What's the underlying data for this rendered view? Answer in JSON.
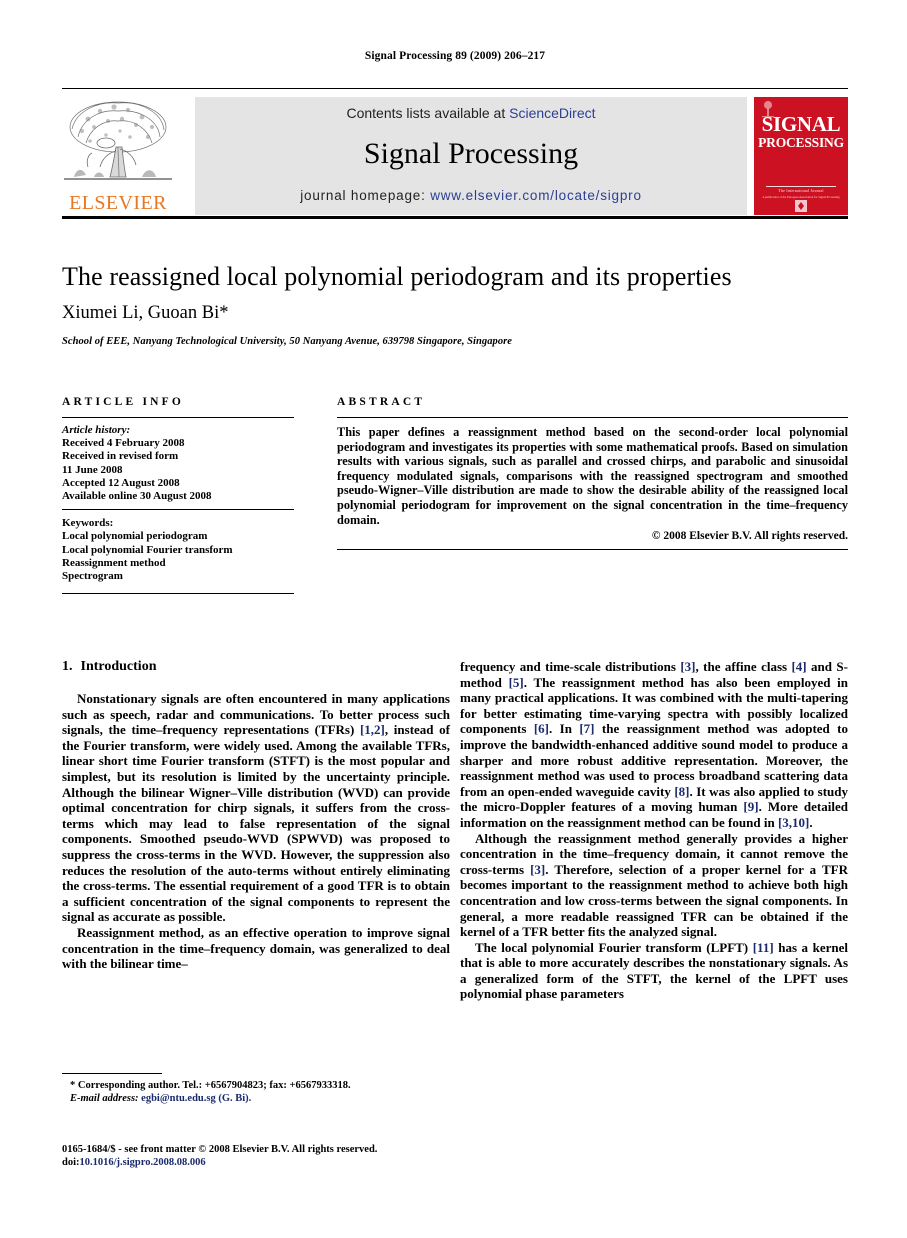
{
  "running_head": "Signal Processing 89 (2009) 206–217",
  "masthead": {
    "contents_prefix": "Contents lists available at ",
    "sciencedirect": "ScienceDirect",
    "journal_name": "Signal Processing",
    "homepage_prefix": "journal homepage: ",
    "homepage_url": "www.elsevier.com/locate/sigpro",
    "publisher_wordmark": "ELSEVIER",
    "cover": {
      "line1": "SIGNAL",
      "line2": "PROCESSING",
      "sub1": "The International Journal",
      "sub2": "A publication of the European Association for Signal Processing"
    },
    "accent_red": "#cc1122",
    "accent_orange": "#E87722",
    "link_blue": "#2b3f93",
    "band_gray": "#e4e4e4"
  },
  "article": {
    "title": "The reassigned local polynomial periodogram and its properties",
    "authors": "Xiumei Li, Guoan Bi*",
    "affiliation": "School of EEE, Nanyang Technological University, 50 Nanyang Avenue, 639798 Singapore, Singapore"
  },
  "info": {
    "heading": "ARTICLE INFO",
    "history_label": "Article history:",
    "history": [
      "Received 4 February 2008",
      "Received in revised form",
      "11 June 2008",
      "Accepted 12 August 2008",
      "Available online 30 August 2008"
    ],
    "keywords_label": "Keywords:",
    "keywords": [
      "Local polynomial periodogram",
      "Local polynomial Fourier transform",
      "Reassignment method",
      "Spectrogram"
    ]
  },
  "abstract": {
    "heading": "ABSTRACT",
    "text": "This paper defines a reassignment method based on the second-order local polynomial periodogram and investigates its properties with some mathematical proofs. Based on simulation results with various signals, such as parallel and crossed chirps, and parabolic and sinusoidal frequency modulated signals, comparisons with the reassigned spectrogram and smoothed pseudo-Wigner–Ville distribution are made to show the desirable ability of the reassigned local polynomial periodogram for improvement on the signal concentration in the time–frequency domain.",
    "copyright": "© 2008 Elsevier B.V. All rights reserved."
  },
  "body": {
    "section_number": "1.",
    "section_title": "Introduction",
    "left_p1_a": "Nonstationary signals are often encountered in many applications such as speech, radar and communications. To better process such signals, the time–frequency representations (TFRs) ",
    "left_p1_ref1": "[1,2]",
    "left_p1_b": ", instead of the Fourier transform, were widely used. Among the available TFRs, linear short time Fourier transform (STFT) is the most popular and simplest, but its resolution is limited by the uncertainty principle. Although the bilinear Wigner–Ville distribution (WVD) can provide optimal concentration for chirp signals, it suffers from the cross-terms which may lead to false representation of the signal components. Smoothed pseudo-WVD (SPWVD) was proposed to suppress the cross-terms in the WVD. However, the suppression also reduces the resolution of the auto-terms without entirely eliminating the cross-terms. The essential requirement of a good TFR is to obtain a sufficient concentration of the signal components to represent the signal as accurate as possible.",
    "left_p2": "Reassignment method, as an effective operation to improve signal concentration in the time–frequency domain, was generalized to deal with the bilinear time–",
    "right_p1_a": "frequency and time-scale distributions ",
    "right_p1_ref3": "[3]",
    "right_p1_b": ", the affine class ",
    "right_p1_ref4": "[4]",
    "right_p1_c": " and S-method ",
    "right_p1_ref5": "[5]",
    "right_p1_d": ". The reassignment method has also been employed in many practical applications. It was combined with the multi-tapering for better estimating time-varying spectra with possibly localized components ",
    "right_p1_ref6": "[6]",
    "right_p1_e": ". In ",
    "right_p1_ref7": "[7]",
    "right_p1_f": " the reassignment method was adopted to improve the bandwidth-enhanced additive sound model to produce a sharper and more robust additive representation. Moreover, the reassignment method was used to process broadband scattering data from an open-ended waveguide cavity ",
    "right_p1_ref8": "[8]",
    "right_p1_g": ". It was also applied to study the micro-Doppler features of a moving human ",
    "right_p1_ref9": "[9]",
    "right_p1_h": ". More detailed information on the reassignment method can be found in ",
    "right_p1_ref10": "[3,10]",
    "right_p1_i": ".",
    "right_p2_a": "Although the reassignment method generally provides a higher concentration in the time–frequency domain, it cannot remove the cross-terms ",
    "right_p2_ref3": "[3]",
    "right_p2_b": ". Therefore, selection of a proper kernel for a TFR becomes important to the reassignment method to achieve both high concentration and low cross-terms between the signal components. In general, a more readable reassigned TFR can be obtained if the kernel of a TFR better fits the analyzed signal.",
    "right_p3_a": "The local polynomial Fourier transform (LPFT) ",
    "right_p3_ref11": "[11]",
    "right_p3_b": " has a kernel that is able to more accurately describes the nonstationary signals. As a generalized form of the STFT, the kernel of the LPFT uses polynomial phase parameters"
  },
  "footnote": {
    "marker": "*",
    "corresponding": " Corresponding author. Tel.: +6567904823; fax: +6567933318.",
    "email_label": "E-mail address:",
    "email": "egbi@ntu.edu.sg (G. Bi).",
    "issn_line": "0165-1684/$ - see front matter © 2008 Elsevier B.V. All rights reserved.",
    "doi_prefix": "doi:",
    "doi": "10.1016/j.sigpro.2008.08.006"
  }
}
